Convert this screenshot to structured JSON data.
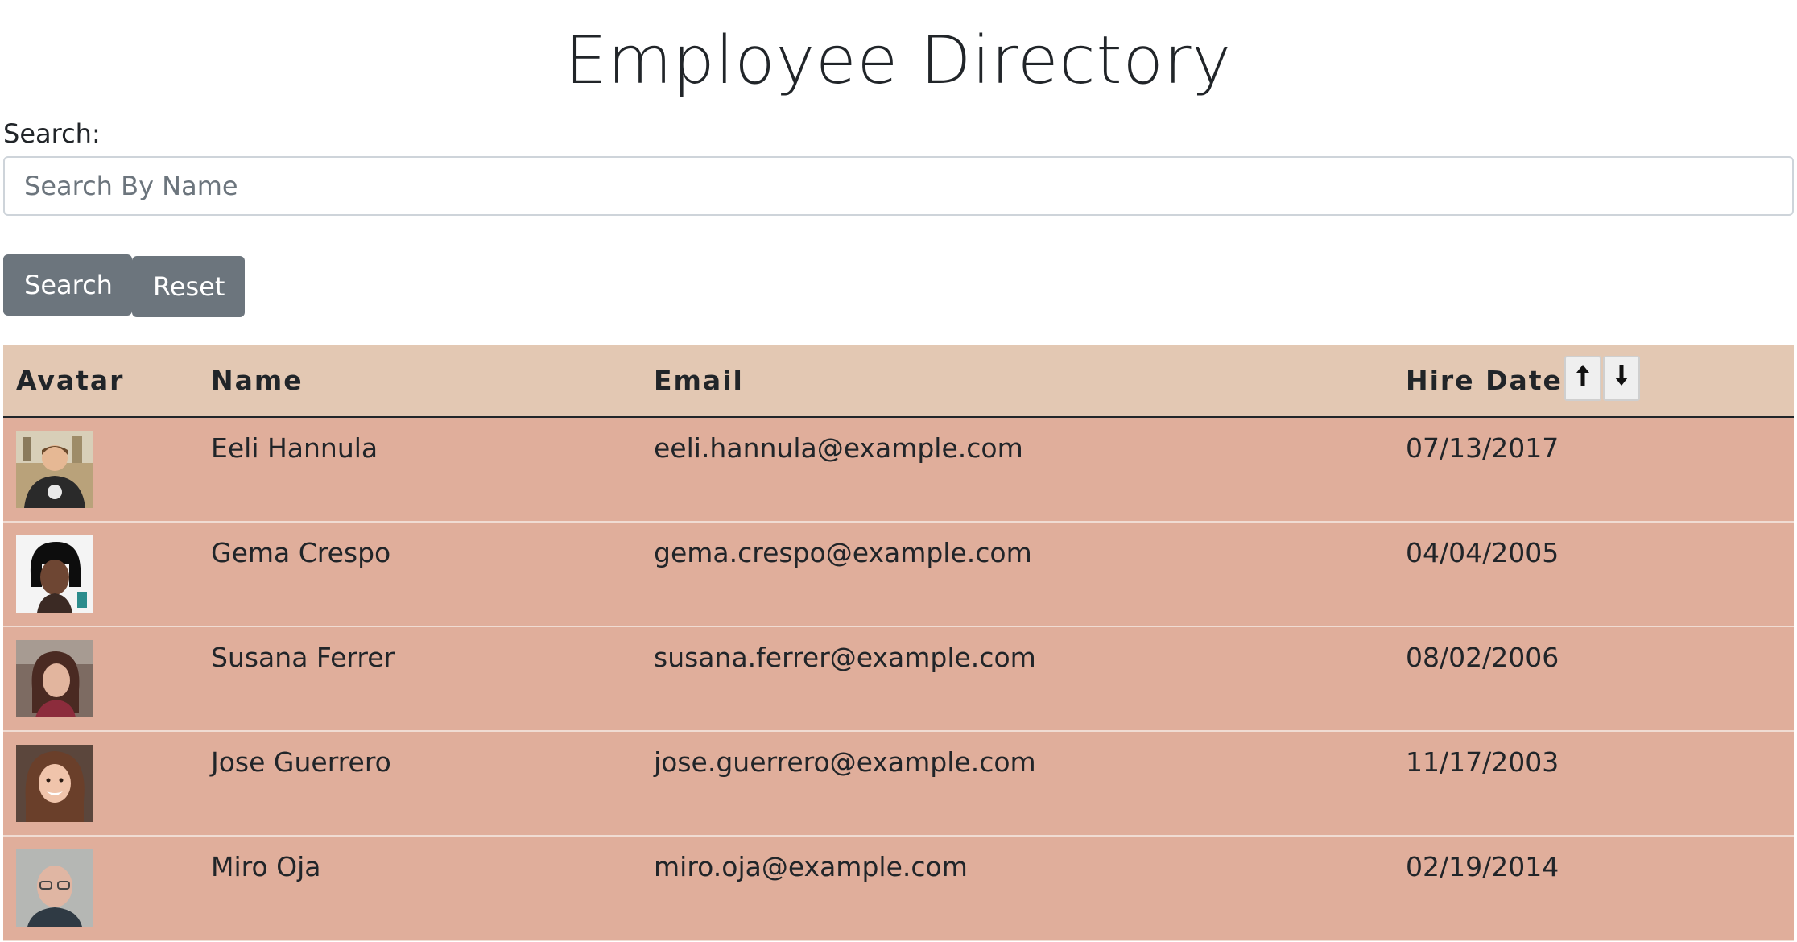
{
  "header": {
    "title": "Employee Directory"
  },
  "search": {
    "label": "Search:",
    "placeholder": "Search By Name",
    "value": "",
    "search_button": "Search",
    "reset_button": "Reset"
  },
  "table": {
    "columns": {
      "avatar": "Avatar",
      "name": "Name",
      "email": "Email",
      "hire_date": "Hire Date"
    },
    "sort_ascending_glyph": "🠕",
    "sort_descending_glyph": "🠗",
    "rows": [
      {
        "avatar": "avatar-photo",
        "name": "Eeli Hannula",
        "email": "eeli.hannula@example.com",
        "hire_date": "07/13/2017"
      },
      {
        "avatar": "avatar-photo",
        "name": "Gema Crespo",
        "email": "gema.crespo@example.com",
        "hire_date": "04/04/2005"
      },
      {
        "avatar": "avatar-photo",
        "name": "Susana Ferrer",
        "email": "susana.ferrer@example.com",
        "hire_date": "08/02/2006"
      },
      {
        "avatar": "avatar-photo",
        "name": "Jose Guerrero",
        "email": "jose.guerrero@example.com",
        "hire_date": "11/17/2003"
      },
      {
        "avatar": "avatar-photo",
        "name": "Miro Oja",
        "email": "miro.oja@example.com",
        "hire_date": "02/19/2014"
      }
    ]
  },
  "colors": {
    "header_row": "#e3c8b3",
    "body_row": "#e0ae9b",
    "button": "#6c757d"
  }
}
